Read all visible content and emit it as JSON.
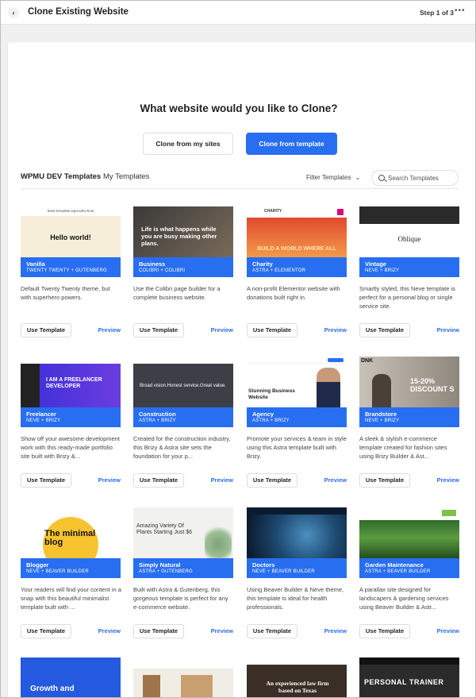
{
  "header": {
    "back_icon": "chevron-left-icon",
    "title": "Clone Existing Website",
    "step": "Step 1 of 3",
    "more_icon": "more-dots-icon"
  },
  "main": {
    "question": "What website would you like to Clone?",
    "clone_sites_label": "Clone from my sites",
    "clone_template_label": "Clone from template",
    "tabs": [
      {
        "label": "WPMU DEV Templates",
        "active": true
      },
      {
        "label": "My Templates",
        "active": false
      }
    ],
    "filter_label": "Filter Templates",
    "search_placeholder": "Search Templates"
  },
  "accent_color": "#286ef1",
  "templates": [
    {
      "name": "Vanilla",
      "stack": "TWENTY TWENTY + GUTENBERG",
      "desc": "Default Twenty Twenty theme, but with superhero powers.",
      "thumb_heading": "Hello world!",
      "thumb_url": "base-template.wpmudev.host"
    },
    {
      "name": "Business",
      "stack": "COLIBRI + COLIBRI",
      "desc": "Use the Colibri page builder for a complete business website.",
      "thumb_heading": "Life is what happens while you are busy making other plans."
    },
    {
      "name": "Charity",
      "stack": "ASTRA + ELEMENTOR",
      "desc": "A non-profit Elementor website with donations built right in.",
      "thumb_heading": "BUILD A WORLD WHERE ALL",
      "thumb_brand": "CHARITY"
    },
    {
      "name": "Vintage",
      "stack": "NEVE + BRIZY",
      "desc": "Smartly styled, this Neve template is perfect for a personal blog or single service site.",
      "thumb_heading": "Oblique"
    },
    {
      "name": "Freelancer",
      "stack": "NEVE + BRIZY",
      "desc": "Show off your awesome development work with this ready-made portfolio site built with Brizy &...",
      "thumb_heading": "I AM A FREELANCER DEVELOPER"
    },
    {
      "name": "Construction",
      "stack": "ASTRA + BRIZY",
      "desc": "Created for the construction industry, this Brizy & Astra site sets the foundation for your p...",
      "thumb_heading": "Broad vision.Honest service.Great value."
    },
    {
      "name": "Agency",
      "stack": "ASTRA + BRIZY",
      "desc": "Promote your services & team in style using this Astra template built with Brizy.",
      "thumb_heading": "Stunning Business Website"
    },
    {
      "name": "Brandstore",
      "stack": "NEVE + BRIZY",
      "desc": "A sleek & stylish e-commerce template created for fashion sites using Brizy Builder & Ast...",
      "thumb_heading": "15-20% DISCOUNT S",
      "thumb_brand": "DNK"
    },
    {
      "name": "Blogger",
      "stack": "NEVE + BEAVER BUILDER",
      "desc": "Your readers will find your content in a snap with this beautiful minimalist template built with ...",
      "thumb_heading": "The minimal blog"
    },
    {
      "name": "Simply Natural",
      "stack": "ASTRA + GUTENBERG",
      "desc": "Built with Astra & Gutenberg, this gorgeous template is perfect for any e-commerce website.",
      "thumb_heading": "Amazing Variety Of Plants Starting Just $6"
    },
    {
      "name": "Doctors",
      "stack": "NEVE + BEAVER BUILDER",
      "desc": "Using Beaver Builder & Neve theme, this template is ideal for health professionals.",
      "thumb_heading": ""
    },
    {
      "name": "Garden Maintenance",
      "stack": "ASTRA + BEAVER BUILDER",
      "desc": "A parallax site designed for landscapers & gardening services using Beaver Builder & Astr...",
      "thumb_heading": ""
    },
    {
      "name": "",
      "stack": "",
      "desc": "",
      "thumb_heading": "Growth and"
    },
    {
      "name": "",
      "stack": "",
      "desc": "",
      "thumb_heading": ""
    },
    {
      "name": "",
      "stack": "",
      "desc": "",
      "thumb_heading": "An experienced law firm based on Texas"
    },
    {
      "name": "",
      "stack": "",
      "desc": "",
      "thumb_heading": "PERSONAL TRAINER"
    }
  ],
  "use_template_label": "Use Template",
  "preview_label": "Preview"
}
